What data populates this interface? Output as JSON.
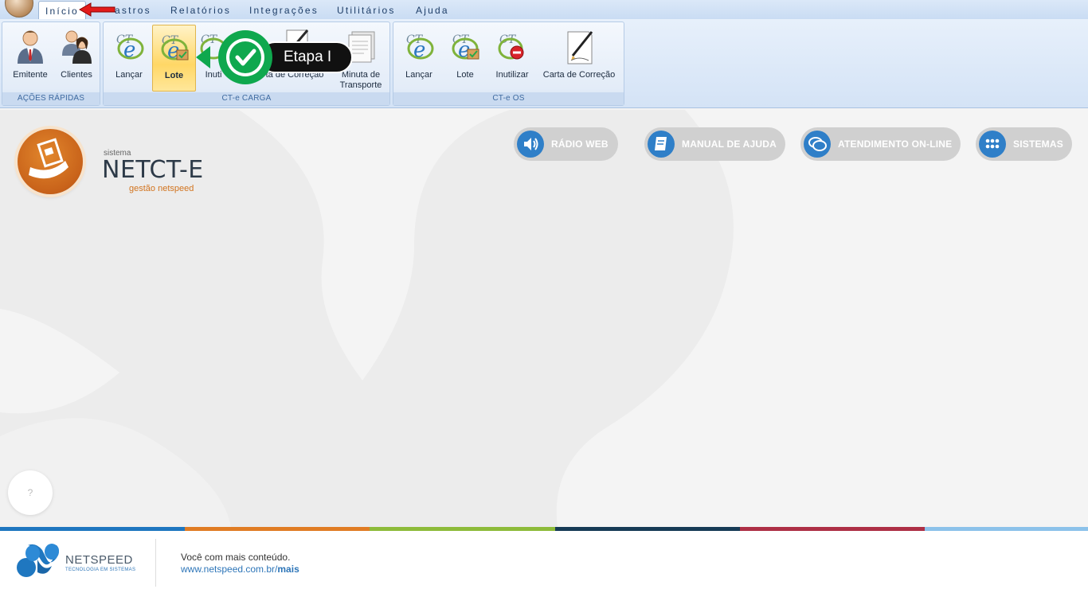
{
  "menu": {
    "tabs": [
      {
        "label": "Início"
      },
      {
        "label": "astros"
      },
      {
        "label": "Relatórios"
      },
      {
        "label": "Integrações"
      },
      {
        "label": "Utilitários"
      },
      {
        "label": "Ajuda"
      }
    ]
  },
  "ribbon": {
    "groups": [
      {
        "label": "AÇÕES RÁPIDAS",
        "buttons": [
          {
            "label": "Emitente",
            "icon": "person-icon"
          },
          {
            "label": "Clientes",
            "icon": "people-icon"
          }
        ]
      },
      {
        "label": "CT-e CARGA",
        "buttons": [
          {
            "label": "Lançar",
            "icon": "cte-icon"
          },
          {
            "label": "Lote",
            "icon": "cte-lote-icon"
          },
          {
            "label": "Inuti",
            "icon": "cte-cancel-icon"
          },
          {
            "label": "ta de Correção",
            "icon": "pencil-doc-icon"
          },
          {
            "label": "Minuta de Transporte",
            "icon": "document-icon"
          }
        ]
      },
      {
        "label": "CT-e OS",
        "buttons": [
          {
            "label": "Lançar",
            "icon": "cte-icon"
          },
          {
            "label": "Lote",
            "icon": "cte-lote-icon"
          },
          {
            "label": "Inutilizar",
            "icon": "cte-cancel-icon"
          },
          {
            "label": "Carta de Correção",
            "icon": "pencil-doc-icon"
          }
        ]
      }
    ]
  },
  "callout": {
    "text": "Etapa I",
    "color": "#0fa84e"
  },
  "brand": {
    "small": "sistema",
    "name": "NETCT-E",
    "tagline": "gestão netspeed",
    "accent": "#d2741f"
  },
  "actions": [
    {
      "label": "RÁDIO WEB",
      "icon": "speaker-icon"
    },
    {
      "label": "MANUAL DE AJUDA",
      "icon": "book-icon"
    },
    {
      "label": "ATENDIMENTO ON-LINE",
      "icon": "chat-icon"
    },
    {
      "label": "SISTEMAS",
      "icon": "grid-icon"
    }
  ],
  "help": {
    "label": "?"
  },
  "footer": {
    "stripe_colors": [
      "#1f77c0",
      "#e07c24",
      "#8dbb3a",
      "#163a55",
      "#ad2f45",
      "#8cc2ea"
    ],
    "company": "NETSPEED",
    "company_sub": "TECNOLOGIA EM SISTEMAS",
    "line1": "Você com mais conteúdo.",
    "url_base": "www.netspeed.com.br/",
    "url_bold": "mais"
  }
}
